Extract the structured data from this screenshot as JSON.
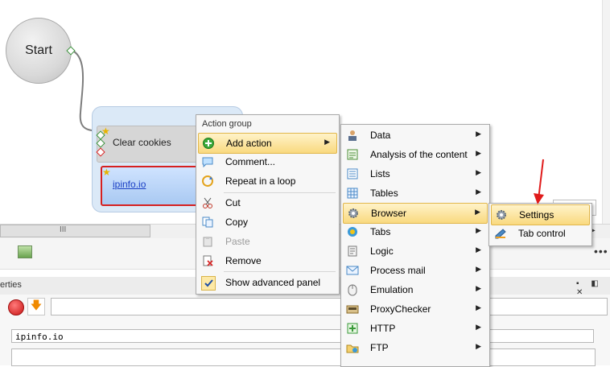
{
  "canvas": {
    "start_label": "Start",
    "clear_cookies_label": "Clear cookies",
    "ipinfo_label": "ipinfo.io"
  },
  "hscroll": {
    "grip": "III",
    "right_arrow": "▶"
  },
  "toolbar": {
    "more": "•••"
  },
  "properties": {
    "title": "erties",
    "window_controls": "▪ ◧ ✕",
    "url_value": "ipinfo.io"
  },
  "context_menu": {
    "header": "Action group",
    "items": [
      {
        "label": "Add action",
        "icon": "plus-green-icon",
        "submenu": true,
        "highlighted": true
      },
      {
        "label": "Comment...",
        "icon": "speech-bubble-icon"
      },
      {
        "label": "Repeat in a loop",
        "icon": "loop-icon"
      },
      {
        "label": "Cut",
        "icon": "scissors-icon"
      },
      {
        "label": "Copy",
        "icon": "copy-icon"
      },
      {
        "label": "Paste",
        "icon": "paste-icon",
        "disabled": true
      },
      {
        "label": "Remove",
        "icon": "remove-icon"
      },
      {
        "label": "Show advanced panel",
        "icon": "checkmark-icon",
        "checked": true
      }
    ]
  },
  "action_submenu": {
    "items": [
      {
        "label": "Data",
        "icon": "user-data-icon"
      },
      {
        "label": "Analysis of the content",
        "icon": "analysis-icon"
      },
      {
        "label": "Lists",
        "icon": "list-icon"
      },
      {
        "label": "Tables",
        "icon": "table-icon"
      },
      {
        "label": "Browser",
        "icon": "gear-icon",
        "highlighted": true
      },
      {
        "label": "Tabs",
        "icon": "tabs-icon"
      },
      {
        "label": "Logic",
        "icon": "logic-icon"
      },
      {
        "label": "Process mail",
        "icon": "mail-icon"
      },
      {
        "label": "Emulation",
        "icon": "mouse-icon"
      },
      {
        "label": "ProxyChecker",
        "icon": "proxy-icon"
      },
      {
        "label": "HTTP",
        "icon": "http-icon"
      },
      {
        "label": "FTP",
        "icon": "ftp-icon"
      }
    ]
  },
  "browser_submenu": {
    "items": [
      {
        "label": "Settings",
        "icon": "gear-icon",
        "highlighted": true
      },
      {
        "label": "Tab control",
        "icon": "tab-control-icon"
      }
    ]
  },
  "colors": {
    "highlight": "#f9d97f",
    "annotation_arrow": "#e01b1b",
    "ipinfo_border": "#d62020"
  }
}
